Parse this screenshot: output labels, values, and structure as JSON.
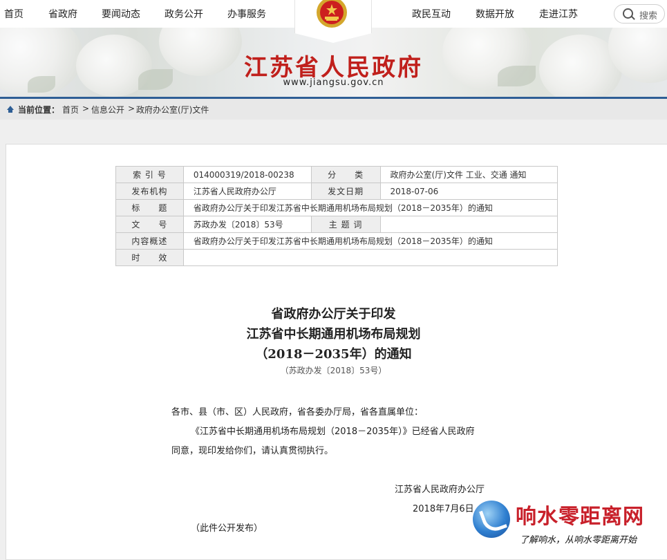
{
  "nav": {
    "left": [
      "首页",
      "省政府",
      "要闻动态",
      "政务公开",
      "办事服务"
    ],
    "right": [
      "政民互动",
      "数据开放",
      "走进江苏"
    ],
    "search_label": "搜索"
  },
  "banner": {
    "title": "江苏省人民政府",
    "url": "www.jiangsu.gov.cn"
  },
  "breadcrumb": {
    "prefix": "当前位置：",
    "items": [
      "首页",
      "信息公开",
      "政府办公室(厅)文件"
    ],
    "separator": ">"
  },
  "meta": {
    "index_label": "索 引 号",
    "index_value": "014000319/2018-00238",
    "category_label": "分　　类",
    "category_value": "政府办公室(厅)文件 工业、交通 通知",
    "publisher_label": "发布机构",
    "publisher_value": "江苏省人民政府办公厅",
    "date_label": "发文日期",
    "date_value": "2018-07-06",
    "title_label": "标　　题",
    "title_value": "省政府办公厅关于印发江苏省中长期通用机场布局规划（2018－2035年）的通知",
    "docno_label": "文　　号",
    "docno_value": "苏政办发〔2018〕53号",
    "subject_label": "主 题 词",
    "subject_value": "",
    "summary_label": "内容概述",
    "summary_value": "省政府办公厅关于印发江苏省中长期通用机场布局规划（2018－2035年）的通知",
    "validity_label": "时　　效",
    "validity_value": ""
  },
  "document": {
    "title_lines": [
      "省政府办公厅关于印发",
      "江苏省中长期通用机场布局规划",
      "（2018－2035年）的通知"
    ],
    "doc_number": "（苏政办发〔2018〕53号）",
    "addressee": "各市、县（市、区）人民政府，省各委办厅局，省各直属单位：",
    "body_line1": "《江苏省中长期通用机场布局规划（2018－2035年）》已经省人民政府",
    "body_line2": "同意，现印发给你们，请认真贯彻执行。",
    "signature": "江苏省人民政府办公厅",
    "date": "2018年7月6日",
    "publish_note": "（此件公开发布）"
  },
  "watermark": {
    "name": "响水零距离网",
    "slogan": "了解响水，从响水零距离开始"
  }
}
